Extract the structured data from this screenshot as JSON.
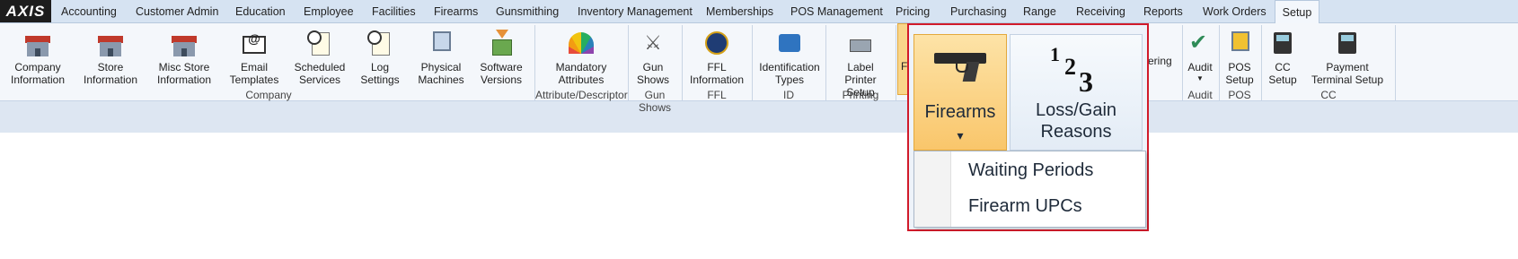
{
  "app": {
    "logo": "AXIS"
  },
  "menu": [
    "Accounting",
    "Customer Admin",
    "Education",
    "Employee",
    "Facilities",
    "Firearms",
    "Gunsmithing",
    "Inventory Management",
    "Memberships",
    "POS Management",
    "Pricing",
    "Purchasing",
    "Range",
    "Receiving",
    "Reports",
    "Work Orders",
    "Setup"
  ],
  "menu_active": "Setup",
  "ribbon": {
    "buttons": {
      "company_information": {
        "label": "Company Information",
        "icon": "building-icon"
      },
      "store_information": {
        "label": "Store Information",
        "icon": "store-icon"
      },
      "misc_store_information": {
        "label": "Misc Store Information",
        "icon": "store-icon"
      },
      "email_templates": {
        "label": "Email Templates",
        "icon": "envelope-icon"
      },
      "scheduled_services": {
        "label": "Scheduled Services",
        "icon": "scheduled-document-icon"
      },
      "log_settings": {
        "label": "Log Settings",
        "icon": "log-document-icon"
      },
      "physical_machines": {
        "label": "Physical Machines",
        "icon": "monitor-icon"
      },
      "software_versions": {
        "label": "Software Versions",
        "icon": "package-icon"
      },
      "mandatory_attributes": {
        "label": "Mandatory Attributes",
        "icon": "color-fan-icon"
      },
      "gun_shows": {
        "label": "Gun Shows",
        "icon": "pistols-icon"
      },
      "ffl_information": {
        "label": "FFL Information",
        "icon": "seal-icon"
      },
      "identification_types": {
        "label": "Identification Types",
        "icon": "id-card-icon"
      },
      "label_printer_setup": {
        "label": "Label Printer Setup",
        "icon": "printer-icon"
      },
      "partial_firearms": {
        "label": "F"
      },
      "partial_loss": {
        "label": "1"
      },
      "partial_ordering": {
        "label": "ering"
      },
      "audit": {
        "label": "Audit",
        "icon": "checklist-icon"
      },
      "pos_setup": {
        "label": "POS Setup",
        "icon": "pos-icon"
      },
      "cc_setup": {
        "label": "CC Setup",
        "icon": "card-terminal-icon"
      },
      "payment_terminal_setup": {
        "label": "Payment Terminal Setup",
        "icon": "card-terminal-icon"
      }
    },
    "groups": {
      "company": "Company",
      "attribute": "Attribute/Descriptor",
      "gun_shows": "Gun Shows",
      "ffl": "FFL",
      "id": "ID",
      "printing": "Printing",
      "audit": "Audit",
      "pos": "POS",
      "cc": "CC"
    }
  },
  "zoom": {
    "firearms_label": "Firearms",
    "firearms_caret": "▾",
    "loss_gain_label": "Loss/Gain Reasons",
    "loss_gain_glyph": {
      "one": "1",
      "two": "2",
      "three": "3"
    },
    "dropdown": [
      "Waiting Periods",
      "Firearm UPCs"
    ]
  },
  "colors": {
    "highlight_border": "#d11a2a",
    "active_button": "#f9c66b",
    "menubar": "#d6e3f2"
  }
}
